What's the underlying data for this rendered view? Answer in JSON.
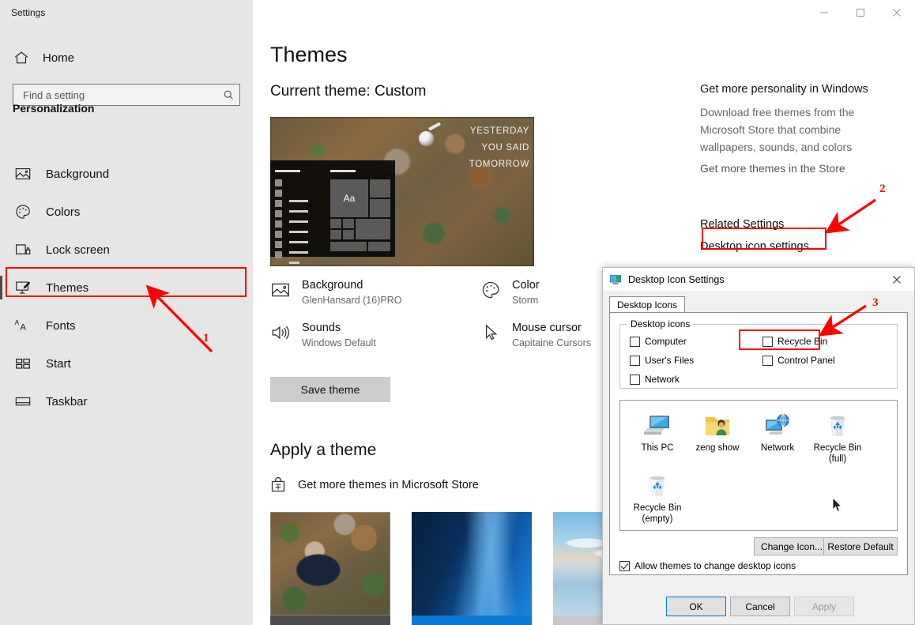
{
  "window": {
    "title": "Settings"
  },
  "titlebar": {
    "minimize": "minimize-icon",
    "maximize": "maximize-icon",
    "close": "close-icon"
  },
  "sidebar": {
    "home_label": "Home",
    "search": {
      "placeholder": "Find a setting",
      "value": ""
    },
    "section": "Personalization",
    "items": [
      {
        "label": "Background",
        "icon": "picture-icon"
      },
      {
        "label": "Colors",
        "icon": "palette-icon"
      },
      {
        "label": "Lock screen",
        "icon": "lock-screen-icon"
      },
      {
        "label": "Themes",
        "icon": "paintbrush-icon"
      },
      {
        "label": "Fonts",
        "icon": "fonts-aa-icon"
      },
      {
        "label": "Start",
        "icon": "start-tiles-icon"
      },
      {
        "label": "Taskbar",
        "icon": "taskbar-icon"
      }
    ],
    "active_item": "Themes"
  },
  "main": {
    "page_title": "Themes",
    "current_theme": "Current theme: Custom",
    "preview": {
      "quote_lines": [
        "YESTERDAY",
        "YOU SAID",
        "TOMORROW"
      ],
      "tile_text": "Aa"
    },
    "settings": [
      {
        "title": "Background",
        "value": "GlenHansard (16)PRO",
        "icon": "picture-icon"
      },
      {
        "title": "Color",
        "value": "Storm",
        "icon": "palette-icon"
      },
      {
        "title": "Sounds",
        "value": "Windows Default",
        "icon": "speaker-icon"
      },
      {
        "title": "Mouse cursor",
        "value": "Capitaine Cursors",
        "icon": "cursor-icon"
      }
    ],
    "save_theme_label": "Save theme",
    "apply_heading": "Apply a theme",
    "store_link": "Get more themes in Microsoft Store",
    "thumbnails": [
      {
        "name": "custom-nature-theme",
        "accent": "#4d4d4d"
      },
      {
        "name": "windows-light-theme",
        "accent": "#0b7ad4"
      },
      {
        "name": "beach-sky-theme",
        "accent": "#c9c9c9"
      }
    ]
  },
  "right_panel": {
    "heading": "Get more personality in Windows",
    "body": "Download free themes from the Microsoft Store that combine wallpapers, sounds, and colors",
    "store_link": "Get more themes in the Store",
    "related_heading": "Related Settings",
    "related_link": "Desktop icon settings"
  },
  "annotations": {
    "markers": [
      "1",
      "2",
      "3"
    ],
    "color": "#fe0000"
  },
  "dialog": {
    "title": "Desktop Icon Settings",
    "icon": "monitor-icon",
    "close_label": "close-icon",
    "tab": "Desktop Icons",
    "group_legend": "Desktop icons",
    "checkboxes": [
      {
        "label": "Computer",
        "checked": false
      },
      {
        "label": "Recycle Bin",
        "checked": false
      },
      {
        "label": "User's Files",
        "checked": false
      },
      {
        "label": "Control Panel",
        "checked": false
      },
      {
        "label": "Network",
        "checked": false
      }
    ],
    "preview_icons": [
      {
        "caption": "This PC",
        "icon": "this-pc-icon"
      },
      {
        "caption": "zeng show",
        "icon": "user-folder-icon"
      },
      {
        "caption": "Network",
        "icon": "network-icon"
      },
      {
        "caption": "Recycle Bin\n(full)",
        "icon": "recycle-bin-full-icon"
      },
      {
        "caption": "Recycle Bin\n(empty)",
        "icon": "recycle-bin-empty-icon"
      }
    ],
    "change_icon_label": "Change Icon...",
    "restore_default_label": "Restore Default",
    "allow_themes_label": "Allow themes to change desktop icons",
    "allow_themes_checked": true,
    "ok_label": "OK",
    "cancel_label": "Cancel",
    "apply_label": "Apply",
    "apply_disabled": true
  }
}
